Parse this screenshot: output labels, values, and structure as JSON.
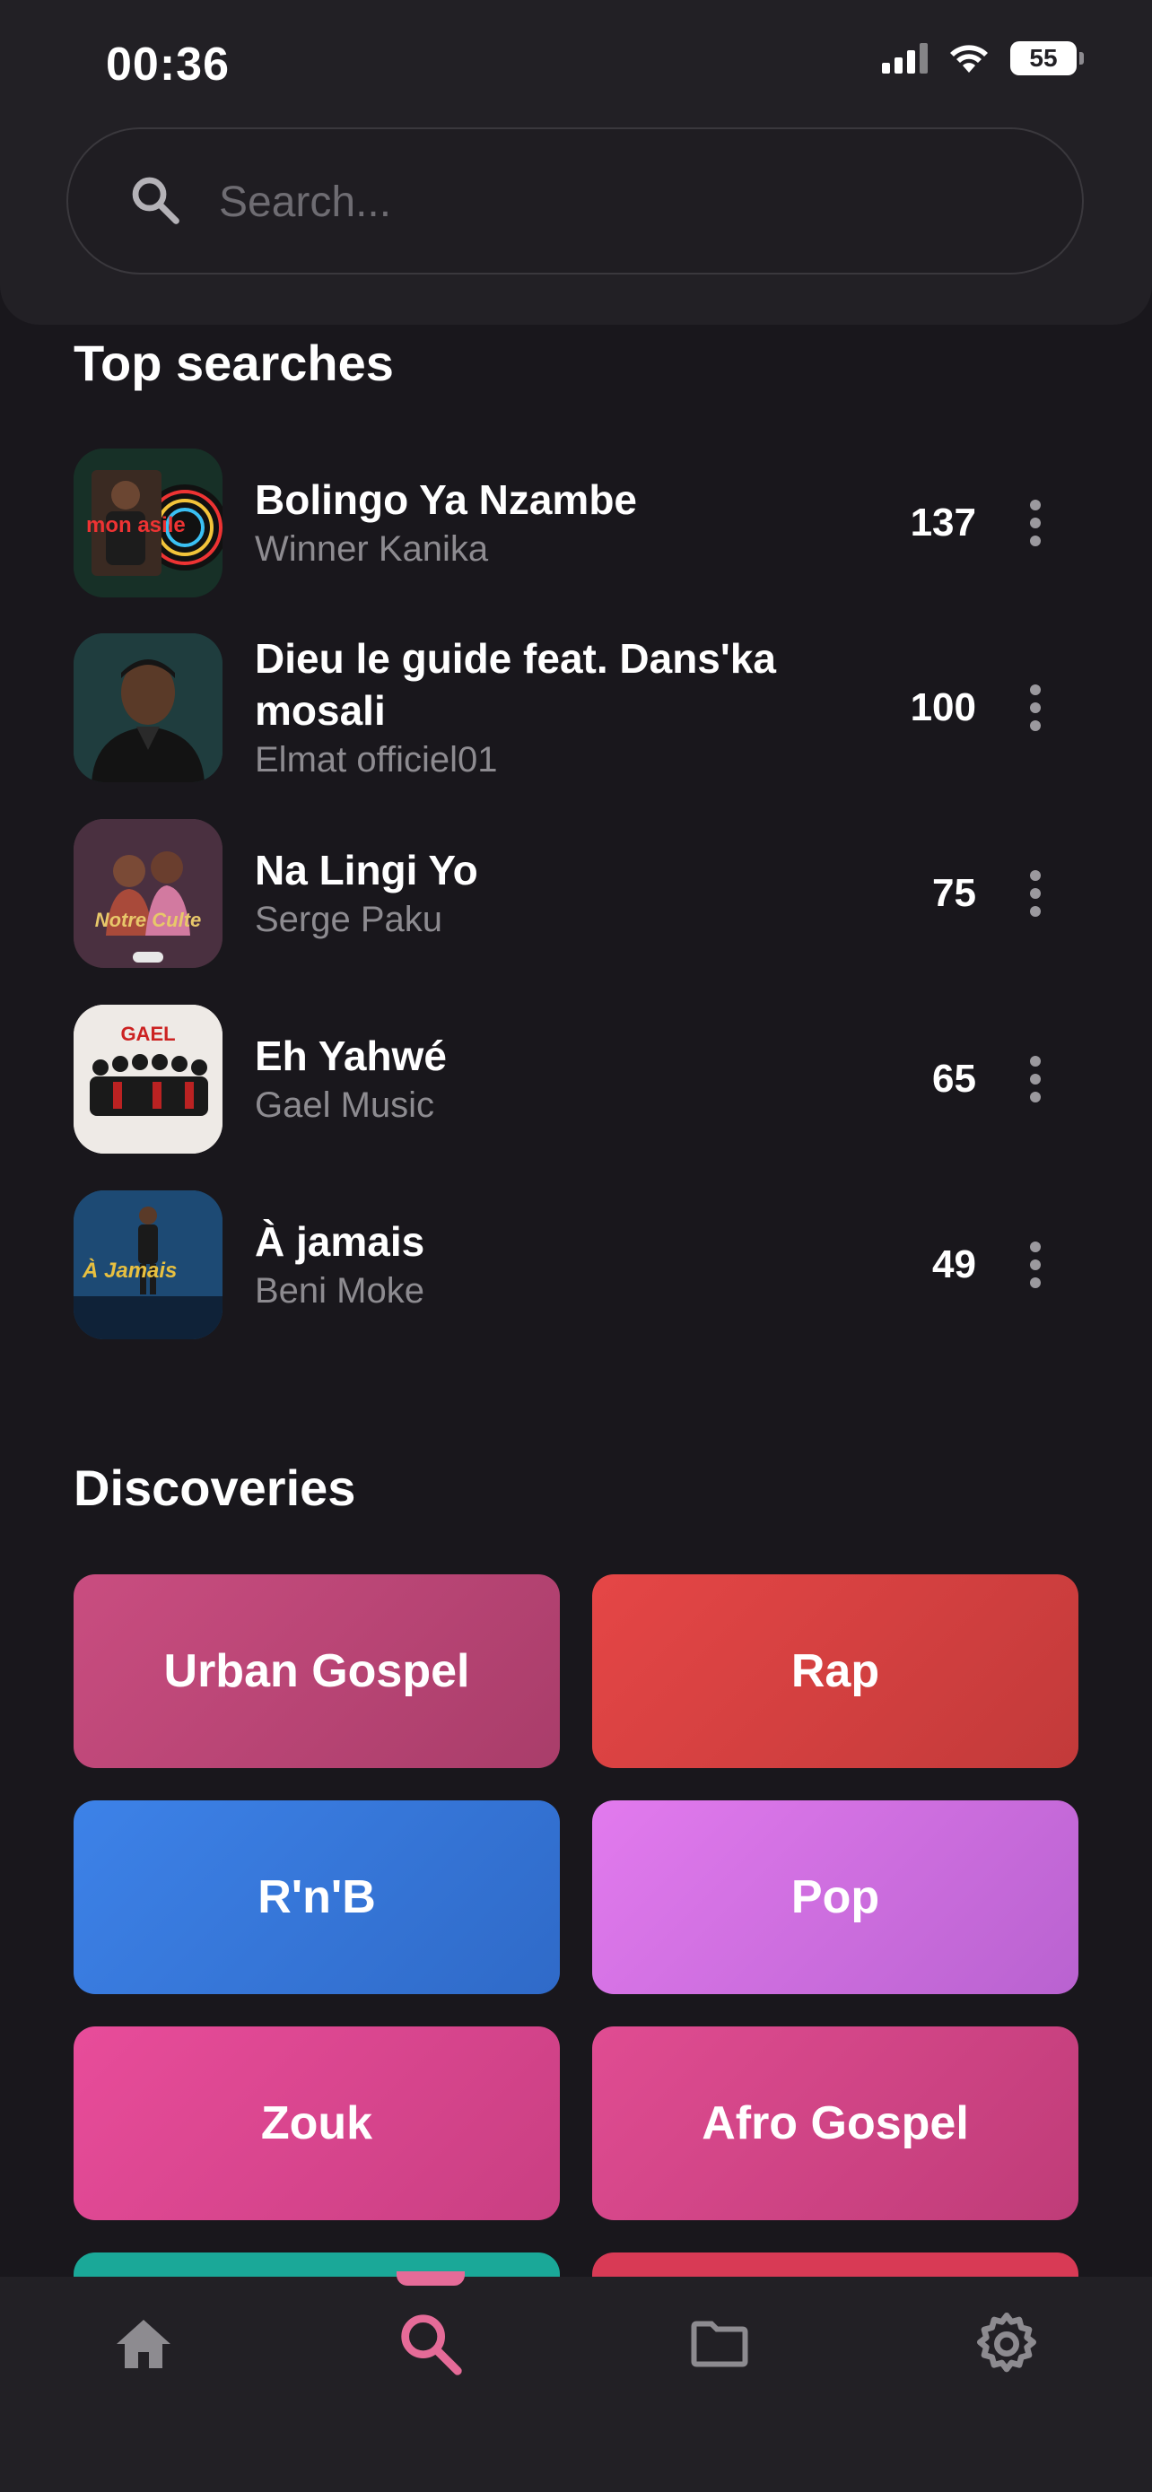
{
  "status_bar": {
    "time": "00:36",
    "battery": "55"
  },
  "search": {
    "placeholder": "Search..."
  },
  "top_searches": {
    "title": "Top searches",
    "items": [
      {
        "title": "Bolingo Ya Nzambe",
        "artist": "Winner Kanika",
        "count": "137",
        "art_caption": "mon asile"
      },
      {
        "title": "Dieu le guide feat. Dans'ka mosali",
        "artist": "Elmat officiel01",
        "count": "100"
      },
      {
        "title": "Na Lingi Yo",
        "artist": "Serge Paku",
        "count": "75",
        "art_caption": "Notre Culte"
      },
      {
        "title": "Eh Yahwé",
        "artist": "Gael Music",
        "count": "65",
        "art_caption": "GAEL"
      },
      {
        "title": "À jamais",
        "artist": "Beni Moke",
        "count": "49",
        "art_caption": "À Jamais"
      }
    ]
  },
  "discoveries": {
    "title": "Discoveries",
    "tiles": [
      {
        "label": "Urban Gospel",
        "color": "#c24a7b"
      },
      {
        "label": "Rap",
        "color": "#e04444"
      },
      {
        "label": "R'n'B",
        "color": "#3a7be0"
      },
      {
        "label": "Pop",
        "color": "#d56de0"
      },
      {
        "label": "Zouk",
        "color": "#e04b93"
      },
      {
        "label": "Afro Gospel",
        "color": "#d94788"
      }
    ]
  },
  "bottom_nav": {
    "items": [
      {
        "icon": "home-icon",
        "active": false
      },
      {
        "icon": "search-icon",
        "active": true
      },
      {
        "icon": "folder-icon",
        "active": false
      },
      {
        "icon": "gear-icon",
        "active": false
      }
    ],
    "active_color": "#e56b98",
    "inactive_color": "#8d8b90"
  }
}
